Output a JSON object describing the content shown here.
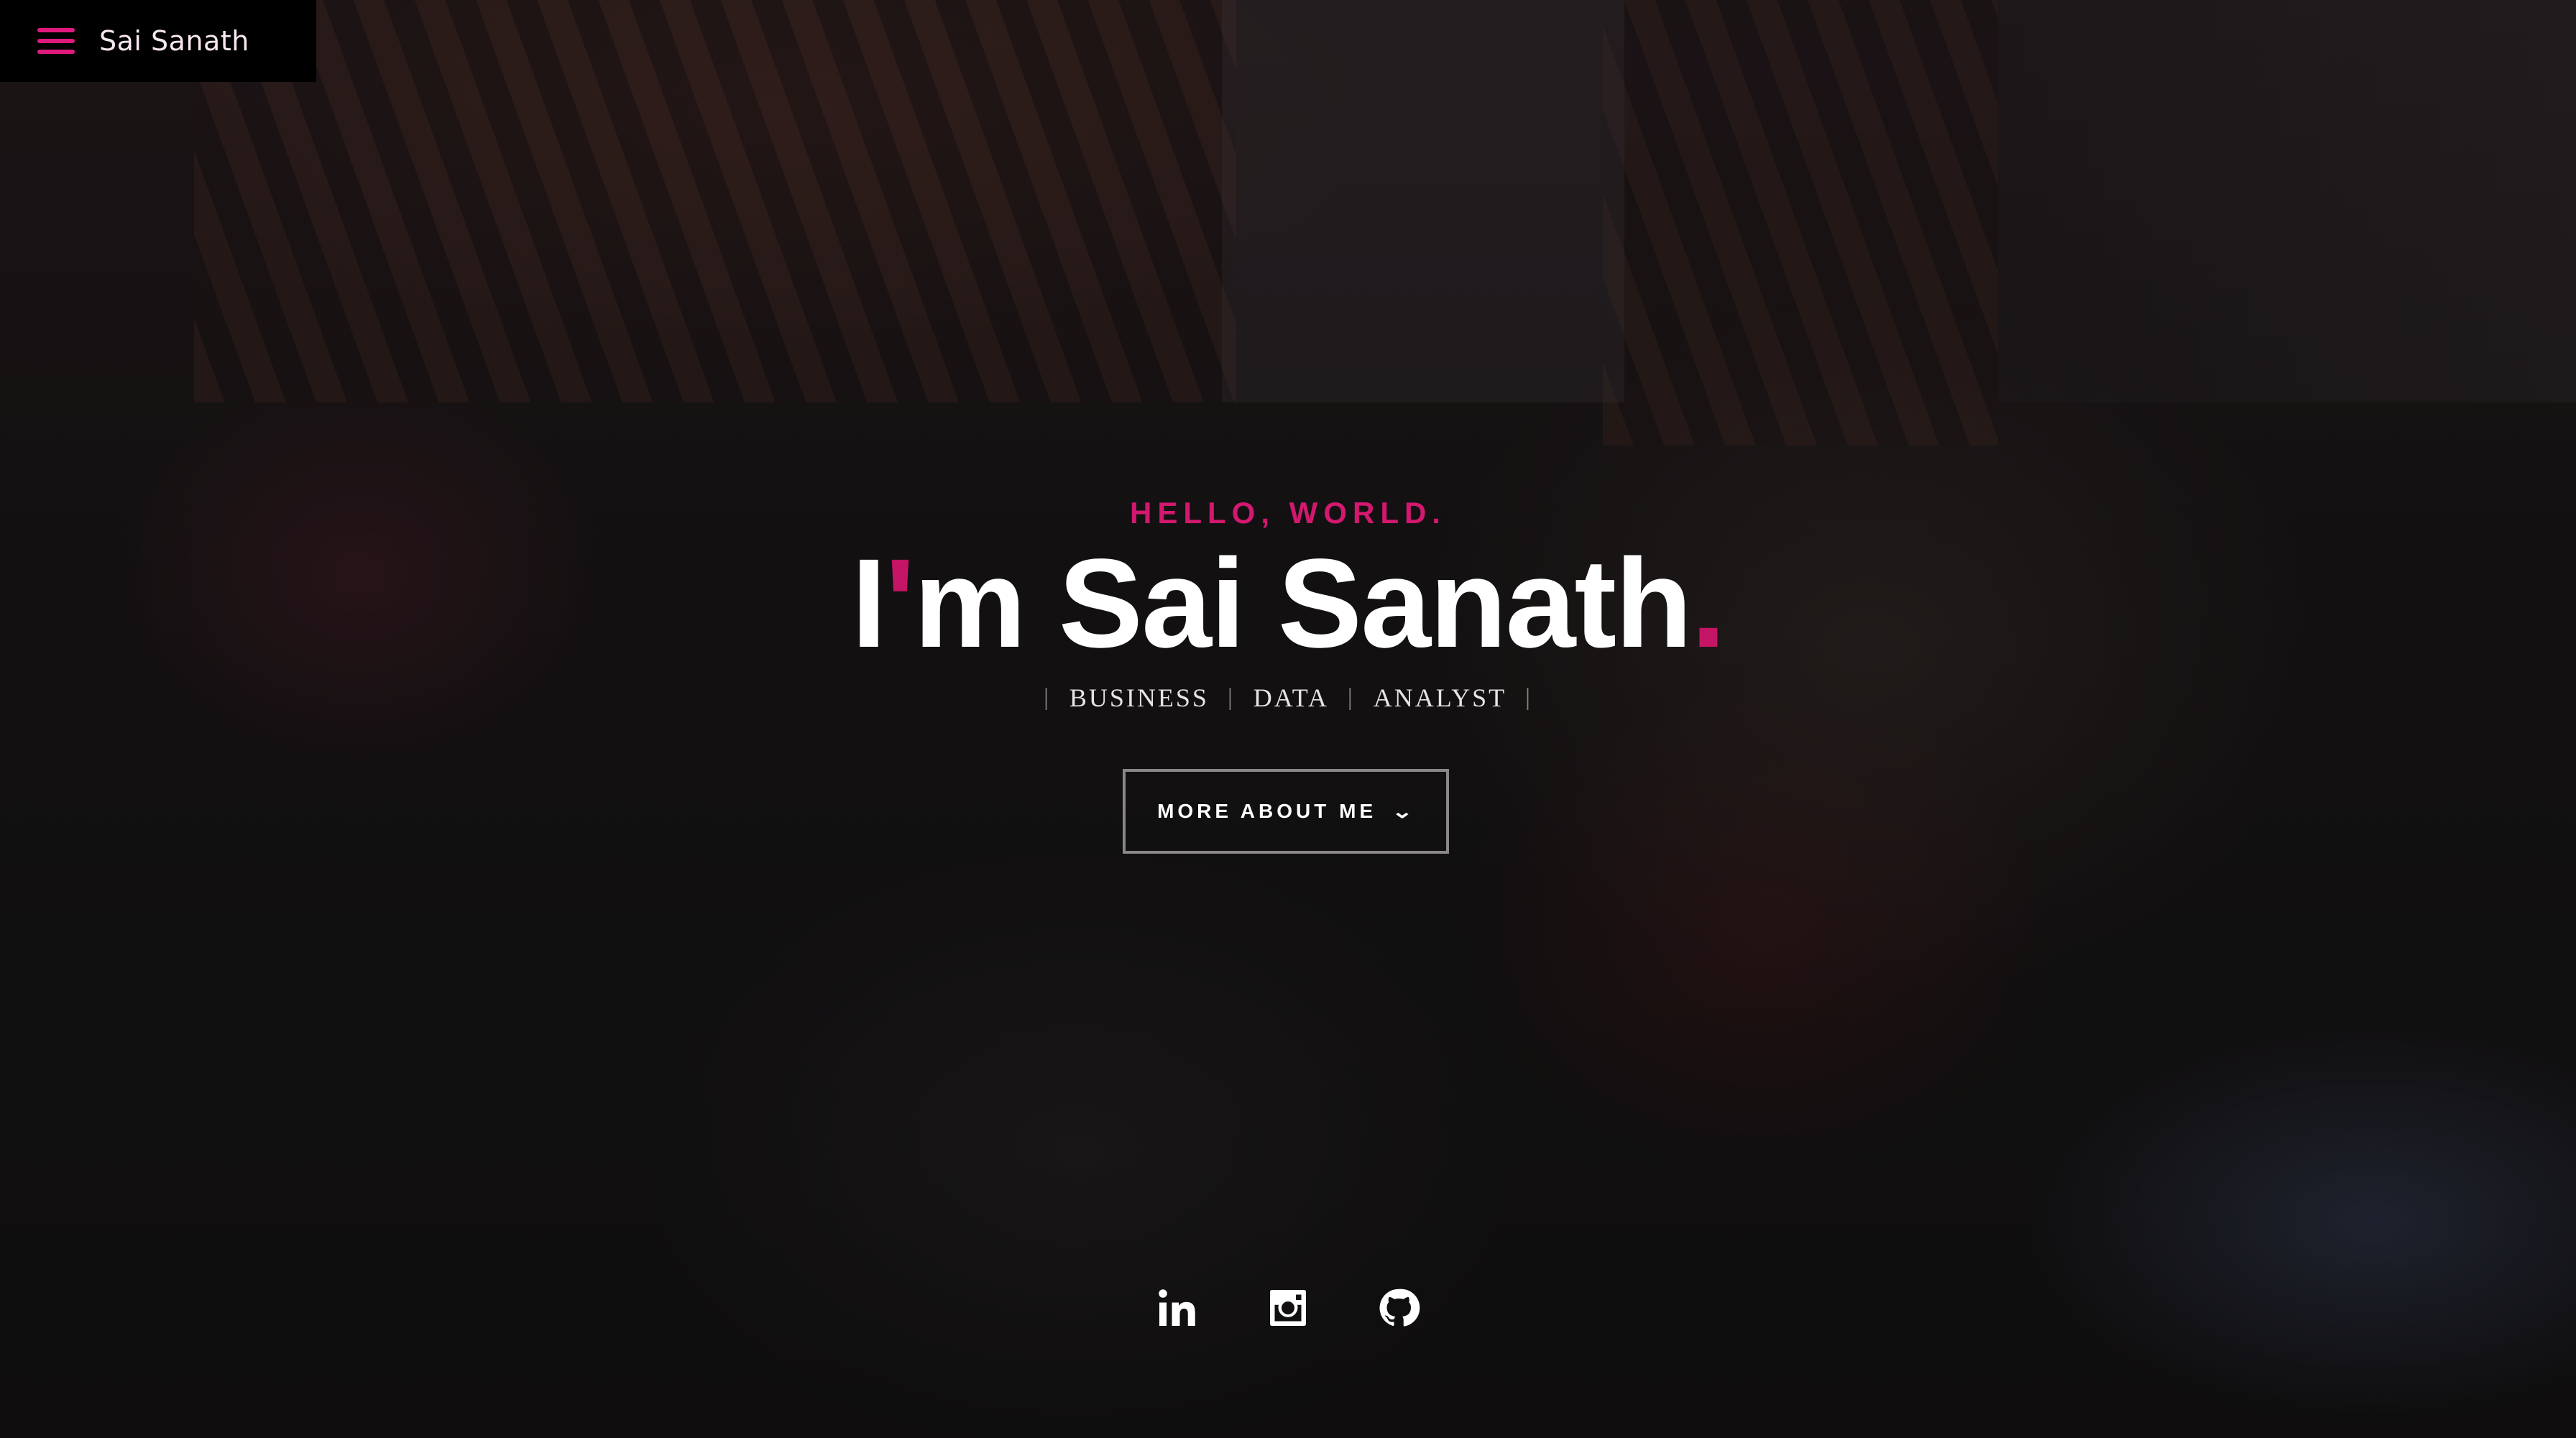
{
  "nav": {
    "brand": "Sai Sanath",
    "menu_icon": "hamburger-menu-icon",
    "accent_color": "#e0197d"
  },
  "hero": {
    "greeting": "HELLO, WORLD.",
    "name_prefix": "I",
    "name_apostrophe": "'",
    "name_main": "m Sai Sanath",
    "name_period": ".",
    "roles": [
      "BUSINESS",
      "DATA",
      "ANALYST"
    ],
    "separator": "|",
    "cta_label": "MORE ABOUT ME",
    "cta_icon": "chevron-down-icon",
    "accent_color": "#c41566"
  },
  "socials": [
    {
      "icon": "linkedin-icon"
    },
    {
      "icon": "instagram-icon"
    },
    {
      "icon": "github-icon"
    }
  ]
}
